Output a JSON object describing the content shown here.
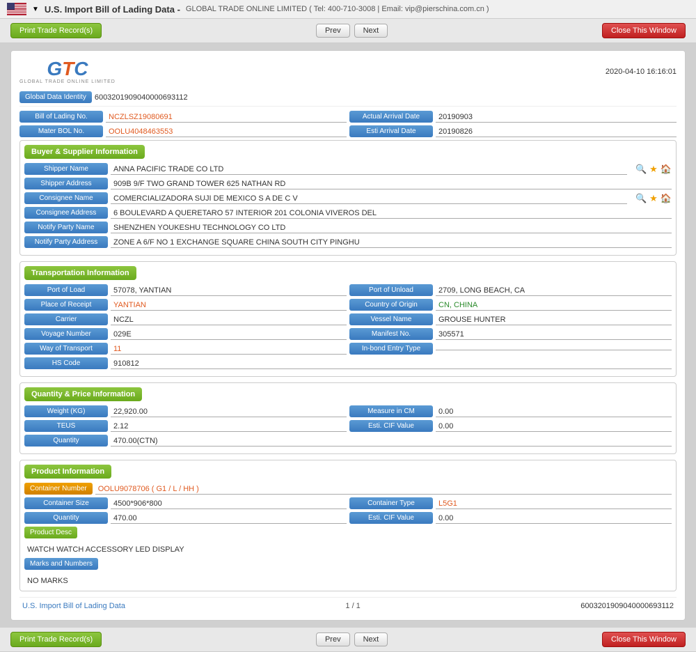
{
  "topbar": {
    "title": "U.S. Import Bill of Lading Data  -",
    "subtitle": "GLOBAL TRADE ONLINE LIMITED ( Tel: 400-710-3008 | Email: vip@pierschina.com.cn )"
  },
  "toolbar": {
    "print_label": "Print Trade Record(s)",
    "prev_label": "Prev",
    "next_label": "Next",
    "close_label": "Close This Window"
  },
  "logo": {
    "text": "GTC",
    "subtitle": "GLOBAL TRADE ONLINE LIMITED",
    "timestamp": "2020-04-10 16:16:01"
  },
  "global_id": {
    "label": "Global Data Identity",
    "value": "6003201909040000693112"
  },
  "bol": {
    "label": "Bill of Lading No.",
    "value": "NCZLSZ19080691",
    "mater_label": "Mater BOL No.",
    "mater_value": "OOLU4048463553",
    "actual_arrival_label": "Actual Arrival Date",
    "actual_arrival_value": "20190903",
    "esti_arrival_label": "Esti Arrival Date",
    "esti_arrival_value": "20190826"
  },
  "buyer_supplier": {
    "section_title": "Buyer & Supplier Information",
    "shipper_name_label": "Shipper Name",
    "shipper_name_value": "ANNA PACIFIC TRADE CO LTD",
    "shipper_address_label": "Shipper Address",
    "shipper_address_value": "909B 9/F TWO GRAND TOWER 625 NATHAN RD",
    "consignee_name_label": "Consignee Name",
    "consignee_name_value": "COMERCIALIZADORA SUJI DE MEXICO S A DE C V",
    "consignee_address_label": "Consignee Address",
    "consignee_address_value": "6 BOULEVARD A QUERETARO 57 INTERIOR 201 COLONIA VIVEROS DEL",
    "notify_party_label": "Notify Party Name",
    "notify_party_value": "SHENZHEN YOUKESHU TECHNOLOGY CO LTD",
    "notify_party_address_label": "Notify Party Address",
    "notify_party_address_value": "ZONE A 6/F NO 1 EXCHANGE SQUARE CHINA SOUTH CITY PINGHU"
  },
  "transport": {
    "section_title": "Transportation Information",
    "port_load_label": "Port of Load",
    "port_load_value": "57078, YANTIAN",
    "port_unload_label": "Port of Unload",
    "port_unload_value": "2709, LONG BEACH, CA",
    "place_receipt_label": "Place of Receipt",
    "place_receipt_value": "YANTIAN",
    "country_origin_label": "Country of Origin",
    "country_origin_value": "CN, CHINA",
    "carrier_label": "Carrier",
    "carrier_value": "NCZL",
    "vessel_name_label": "Vessel Name",
    "vessel_name_value": "GROUSE HUNTER",
    "voyage_label": "Voyage Number",
    "voyage_value": "029E",
    "manifest_label": "Manifest No.",
    "manifest_value": "305571",
    "way_transport_label": "Way of Transport",
    "way_transport_value": "11",
    "inbond_label": "In-bond Entry Type",
    "inbond_value": "",
    "hs_code_label": "HS Code",
    "hs_code_value": "910812"
  },
  "quantity_price": {
    "section_title": "Quantity & Price Information",
    "weight_label": "Weight (KG)",
    "weight_value": "22,920.00",
    "measure_label": "Measure in CM",
    "measure_value": "0.00",
    "teus_label": "TEUS",
    "teus_value": "2.12",
    "esti_cif_label": "Esti. CIF Value",
    "esti_cif_value": "0.00",
    "quantity_label": "Quantity",
    "quantity_value": "470.00(CTN)"
  },
  "product": {
    "section_title": "Product Information",
    "container_number_label": "Container Number",
    "container_number_value": "OOLU9078706 ( G1 / L / HH )",
    "container_size_label": "Container Size",
    "container_size_value": "4500*906*800",
    "container_type_label": "Container Type",
    "container_type_value": "L5G1",
    "quantity_label": "Quantity",
    "quantity_value": "470.00",
    "esti_cif_label": "Esti. CIF Value",
    "esti_cif_value": "0.00",
    "product_desc_label": "Product Desc",
    "product_desc_value": "WATCH WATCH ACCESSORY LED DISPLAY",
    "marks_label": "Marks and Numbers",
    "marks_value": "NO MARKS"
  },
  "footer": {
    "link_text": "U.S. Import Bill of Lading Data",
    "page_text": "1 / 1",
    "id_text": "6003201909040000693112"
  },
  "toolbar2": {
    "print_label": "Print Trade Record(s)",
    "prev_label": "Prev",
    "next_label": "Next",
    "close_label": "Close This Window"
  }
}
